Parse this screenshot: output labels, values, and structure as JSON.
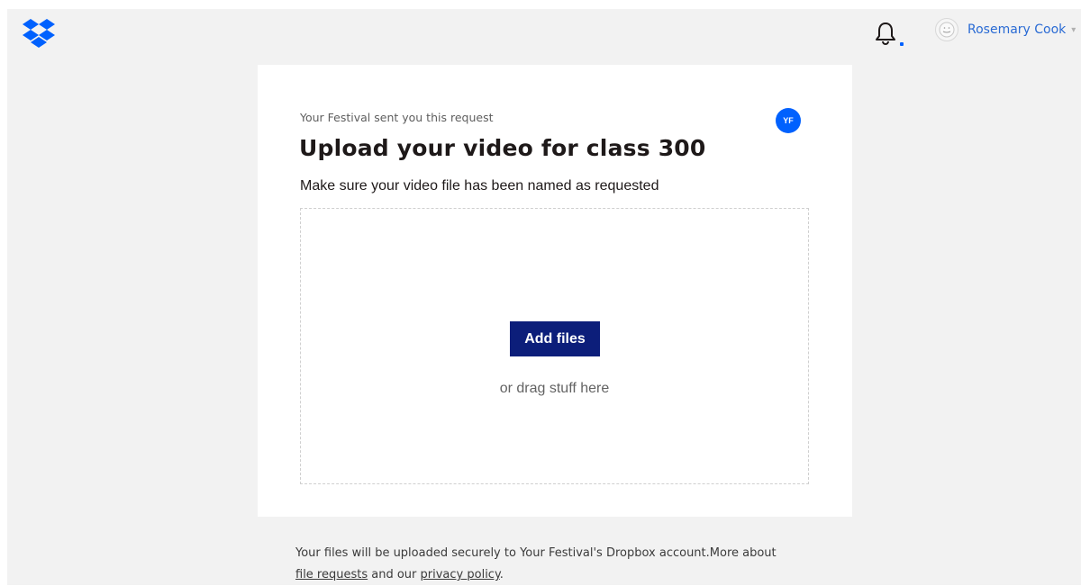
{
  "header": {
    "logo_icon": "dropbox-logo-icon",
    "notification_icon": "bell-icon",
    "user": {
      "name": "Rosemary Cook",
      "avatar_icon": "user-avatar-icon",
      "caret_icon": "chevron-down-icon"
    }
  },
  "request": {
    "requester_line": "Your Festival sent you this request",
    "requester_initials": "YF",
    "title": "Upload your video for class 300",
    "description": "Make sure your video file has been named as requested",
    "add_files_label": "Add files",
    "drag_text": "or drag stuff here"
  },
  "footer": {
    "text_before": "Your files will be uploaded securely to Your Festival's Dropbox account.More about",
    "file_requests_link": "file requests",
    "and_our": " and our ",
    "privacy_link": "privacy policy",
    "period": "."
  },
  "colors": {
    "accent": "#0061fe",
    "button": "#0c1e7a",
    "page_bg": "#f2f2f2",
    "link_user": "#2a6bd4"
  }
}
